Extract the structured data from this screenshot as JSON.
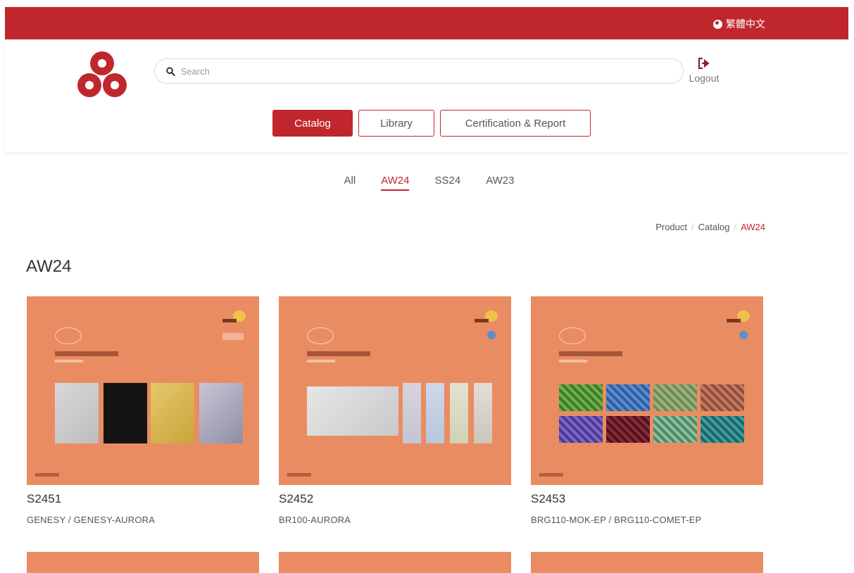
{
  "topbar": {
    "language_label": "繁體中文"
  },
  "header": {
    "search_placeholder": "Search",
    "logout_label": "Logout"
  },
  "nav": {
    "tabs": [
      {
        "label": "Catalog",
        "active": true
      },
      {
        "label": "Library",
        "active": false
      },
      {
        "label": "Certification & Report",
        "active": false
      }
    ]
  },
  "seasons": {
    "items": [
      "All",
      "AW24",
      "SS24",
      "AW23"
    ],
    "active": "AW24"
  },
  "breadcrumb": {
    "items": [
      "Product",
      "Catalog",
      "AW24"
    ]
  },
  "page": {
    "title": "AW24"
  },
  "products": [
    {
      "code": "S2451",
      "name": "GENESY / GENESY-AURORA"
    },
    {
      "code": "S2452",
      "name": "BR100-AURORA"
    },
    {
      "code": "S2453",
      "name": "BRG110-MOK-EP / BRG110-COMET-EP"
    }
  ],
  "colors": {
    "brand_red": "#c0272d",
    "card_orange": "#ea8c62"
  },
  "icons": {
    "language": "globe-icon",
    "search": "search-icon",
    "logout": "logout-icon"
  }
}
